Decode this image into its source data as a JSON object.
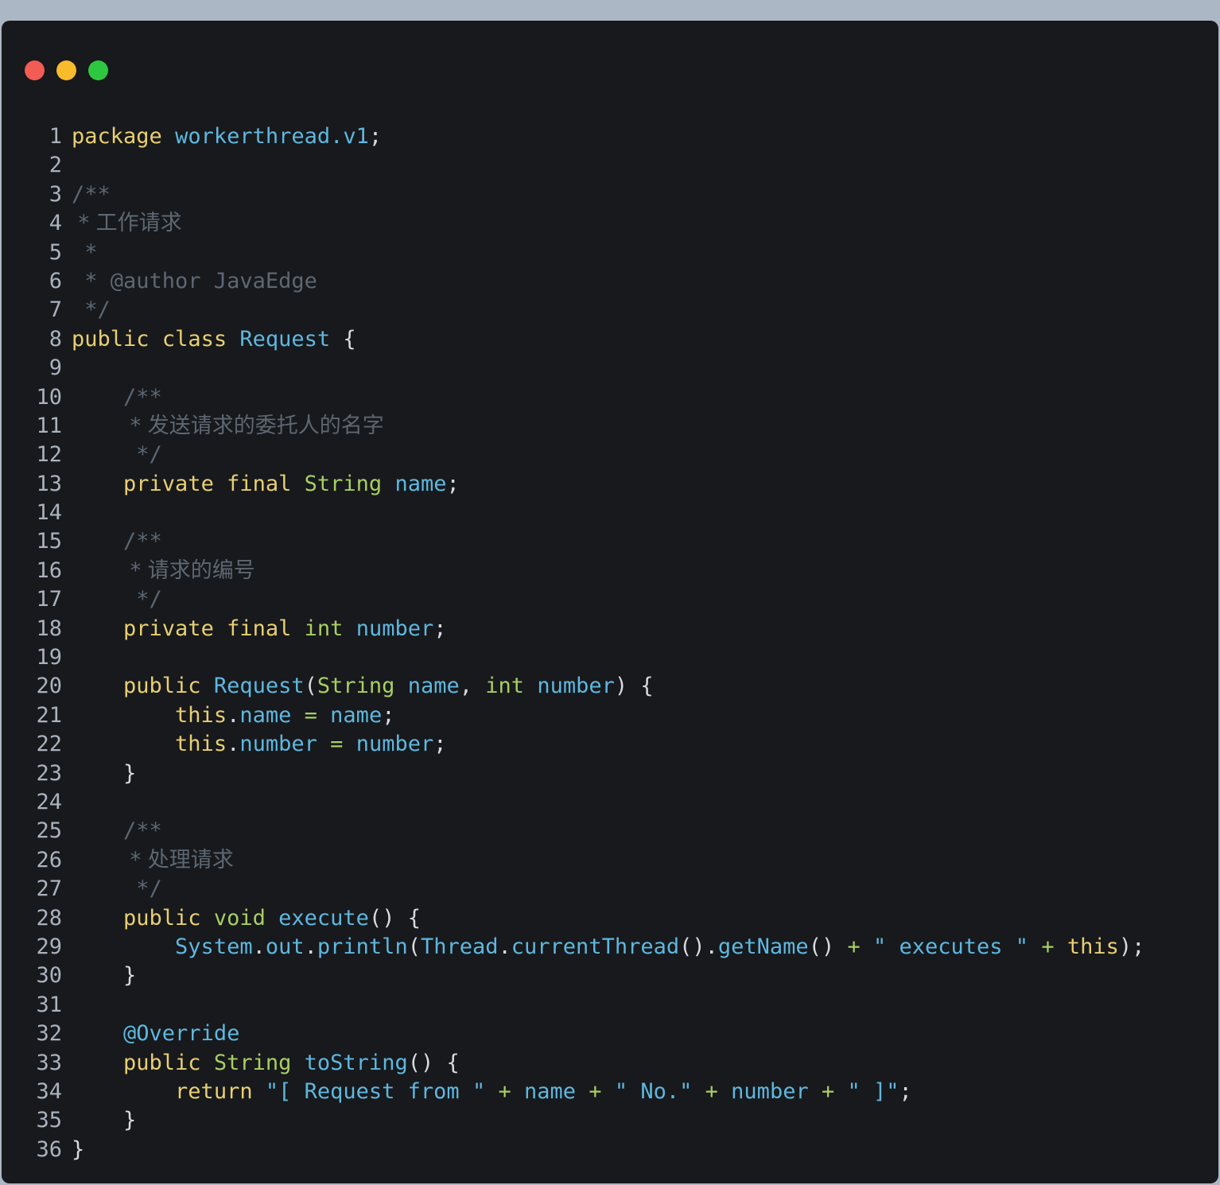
{
  "window": {
    "buttons": [
      {
        "name": "close",
        "color": "#f35b55"
      },
      {
        "name": "minimize",
        "color": "#f8bb2c"
      },
      {
        "name": "maximize",
        "color": "#2ec840"
      }
    ]
  },
  "colors": {
    "keyword": "#e8cf72",
    "identifier": "#5fb7df",
    "type": "#a8cf63",
    "comment": "#5d6772",
    "punct": "#d7dadf",
    "operator": "#a8cf63",
    "string": "#5fb7df",
    "line_number": "#aab2bd"
  },
  "code": {
    "lines": [
      [
        [
          "kw",
          "package"
        ],
        [
          "p",
          " "
        ],
        [
          "id",
          "workerthread.v1"
        ],
        [
          "p",
          ";"
        ]
      ],
      [],
      [
        [
          "cm",
          "/**"
        ]
      ],
      [
        [
          "cm",
          " * 工作请求"
        ]
      ],
      [
        [
          "cm",
          " *"
        ]
      ],
      [
        [
          "cm",
          " * @author JavaEdge"
        ]
      ],
      [
        [
          "cm",
          " */"
        ]
      ],
      [
        [
          "kw",
          "public"
        ],
        [
          "p",
          " "
        ],
        [
          "kw",
          "class"
        ],
        [
          "p",
          " "
        ],
        [
          "id",
          "Request"
        ],
        [
          "p",
          " {"
        ]
      ],
      [],
      [
        [
          "p",
          "    "
        ],
        [
          "cm",
          "/**"
        ]
      ],
      [
        [
          "p",
          "    "
        ],
        [
          "cm",
          " * 发送请求的委托人的名字"
        ]
      ],
      [
        [
          "p",
          "    "
        ],
        [
          "cm",
          " */"
        ]
      ],
      [
        [
          "p",
          "    "
        ],
        [
          "kw",
          "private"
        ],
        [
          "p",
          " "
        ],
        [
          "kw",
          "final"
        ],
        [
          "p",
          " "
        ],
        [
          "ty",
          "String"
        ],
        [
          "p",
          " "
        ],
        [
          "id",
          "name"
        ],
        [
          "p",
          ";"
        ]
      ],
      [],
      [
        [
          "p",
          "    "
        ],
        [
          "cm",
          "/**"
        ]
      ],
      [
        [
          "p",
          "    "
        ],
        [
          "cm",
          " * 请求的编号"
        ]
      ],
      [
        [
          "p",
          "    "
        ],
        [
          "cm",
          " */"
        ]
      ],
      [
        [
          "p",
          "    "
        ],
        [
          "kw",
          "private"
        ],
        [
          "p",
          " "
        ],
        [
          "kw",
          "final"
        ],
        [
          "p",
          " "
        ],
        [
          "ty",
          "int"
        ],
        [
          "p",
          " "
        ],
        [
          "id",
          "number"
        ],
        [
          "p",
          ";"
        ]
      ],
      [],
      [
        [
          "p",
          "    "
        ],
        [
          "kw",
          "public"
        ],
        [
          "p",
          " "
        ],
        [
          "id",
          "Request"
        ],
        [
          "p",
          "("
        ],
        [
          "ty",
          "String"
        ],
        [
          "p",
          " "
        ],
        [
          "id",
          "name"
        ],
        [
          "p",
          ", "
        ],
        [
          "ty",
          "int"
        ],
        [
          "p",
          " "
        ],
        [
          "id",
          "number"
        ],
        [
          "p",
          ") {"
        ]
      ],
      [
        [
          "p",
          "        "
        ],
        [
          "kw",
          "this"
        ],
        [
          "p",
          "."
        ],
        [
          "id",
          "name"
        ],
        [
          "p",
          " "
        ],
        [
          "op",
          "="
        ],
        [
          "p",
          " "
        ],
        [
          "id",
          "name"
        ],
        [
          "p",
          ";"
        ]
      ],
      [
        [
          "p",
          "        "
        ],
        [
          "kw",
          "this"
        ],
        [
          "p",
          "."
        ],
        [
          "id",
          "number"
        ],
        [
          "p",
          " "
        ],
        [
          "op",
          "="
        ],
        [
          "p",
          " "
        ],
        [
          "id",
          "number"
        ],
        [
          "p",
          ";"
        ]
      ],
      [
        [
          "p",
          "    }"
        ]
      ],
      [],
      [
        [
          "p",
          "    "
        ],
        [
          "cm",
          "/**"
        ]
      ],
      [
        [
          "p",
          "    "
        ],
        [
          "cm",
          " * 处理请求"
        ]
      ],
      [
        [
          "p",
          "    "
        ],
        [
          "cm",
          " */"
        ]
      ],
      [
        [
          "p",
          "    "
        ],
        [
          "kw",
          "public"
        ],
        [
          "p",
          " "
        ],
        [
          "ty",
          "void"
        ],
        [
          "p",
          " "
        ],
        [
          "id",
          "execute"
        ],
        [
          "p",
          "() {"
        ]
      ],
      [
        [
          "p",
          "        "
        ],
        [
          "id",
          "System"
        ],
        [
          "p",
          "."
        ],
        [
          "id",
          "out"
        ],
        [
          "p",
          "."
        ],
        [
          "id",
          "println"
        ],
        [
          "p",
          "("
        ],
        [
          "id",
          "Thread"
        ],
        [
          "p",
          "."
        ],
        [
          "id",
          "currentThread"
        ],
        [
          "p",
          "()."
        ],
        [
          "id",
          "getName"
        ],
        [
          "p",
          "() "
        ],
        [
          "op",
          "+"
        ],
        [
          "p",
          " "
        ],
        [
          "st",
          "\" executes \""
        ],
        [
          "p",
          " "
        ],
        [
          "op",
          "+"
        ],
        [
          "p",
          " "
        ],
        [
          "kw",
          "this"
        ],
        [
          "p",
          ");"
        ]
      ],
      [
        [
          "p",
          "    }"
        ]
      ],
      [],
      [
        [
          "p",
          "    "
        ],
        [
          "id",
          "@Override"
        ]
      ],
      [
        [
          "p",
          "    "
        ],
        [
          "kw",
          "public"
        ],
        [
          "p",
          " "
        ],
        [
          "ty",
          "String"
        ],
        [
          "p",
          " "
        ],
        [
          "id",
          "toString"
        ],
        [
          "p",
          "() {"
        ]
      ],
      [
        [
          "p",
          "        "
        ],
        [
          "kw",
          "return"
        ],
        [
          "p",
          " "
        ],
        [
          "st",
          "\"[ Request from \""
        ],
        [
          "p",
          " "
        ],
        [
          "op",
          "+"
        ],
        [
          "p",
          " "
        ],
        [
          "id",
          "name"
        ],
        [
          "p",
          " "
        ],
        [
          "op",
          "+"
        ],
        [
          "p",
          " "
        ],
        [
          "st",
          "\" No.\""
        ],
        [
          "p",
          " "
        ],
        [
          "op",
          "+"
        ],
        [
          "p",
          " "
        ],
        [
          "id",
          "number"
        ],
        [
          "p",
          " "
        ],
        [
          "op",
          "+"
        ],
        [
          "p",
          " "
        ],
        [
          "st",
          "\" ]\""
        ],
        [
          "p",
          ";"
        ]
      ],
      [
        [
          "p",
          "    }"
        ]
      ],
      [
        [
          "p",
          "}"
        ]
      ]
    ]
  }
}
